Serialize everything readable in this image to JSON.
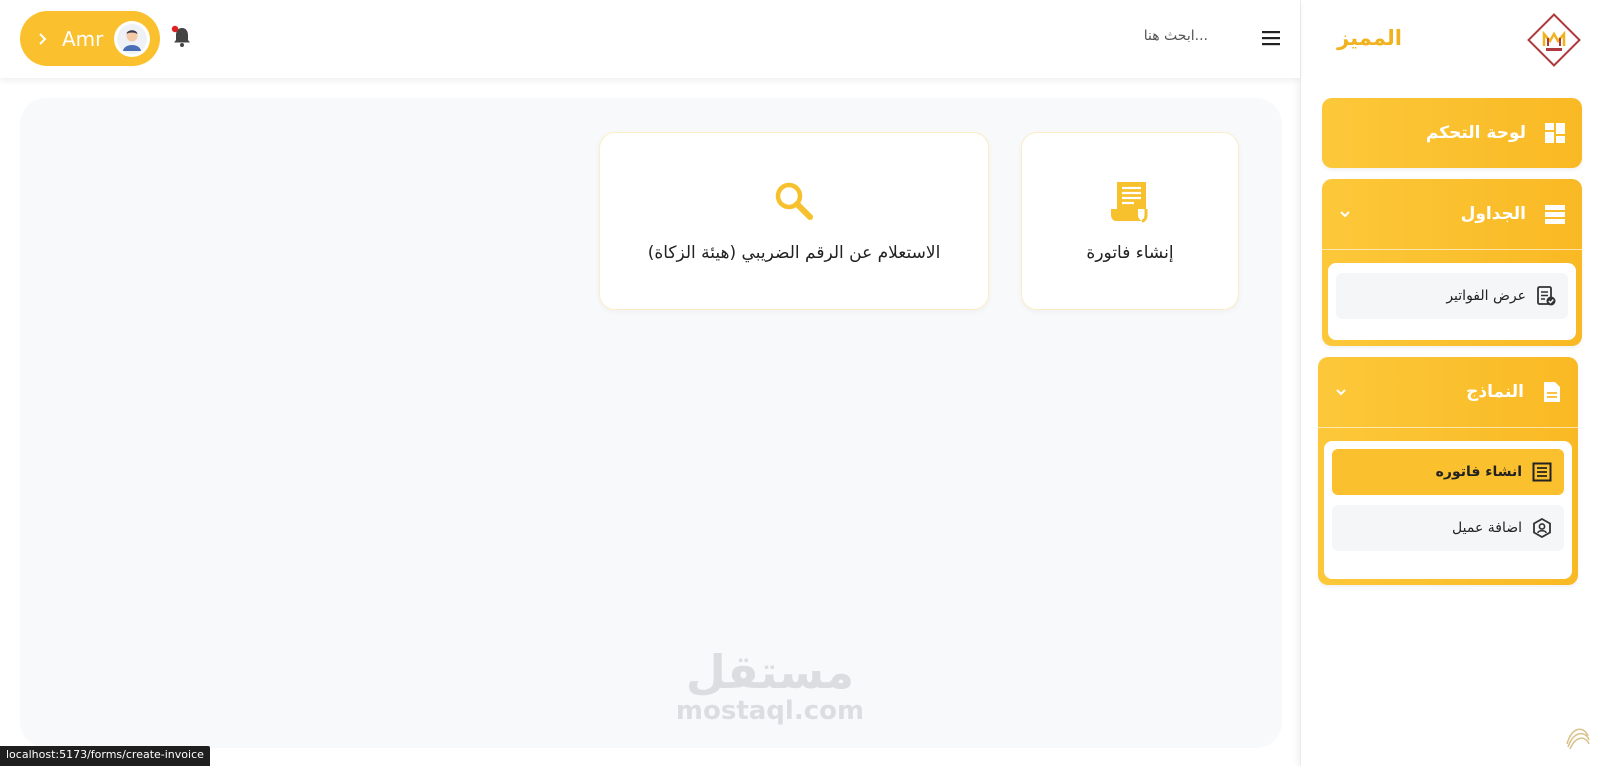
{
  "brand": {
    "name": "المميز"
  },
  "sidebar": {
    "dashboard_label": "لوحة التحكم",
    "tables": {
      "label": "الجداول",
      "items": [
        {
          "label": "عرض الفواتير"
        }
      ]
    },
    "forms": {
      "label": "النماذج",
      "items": [
        {
          "label": "انشاء فاتوره",
          "active": true
        },
        {
          "label": "اضافة عميل",
          "active": false
        }
      ]
    }
  },
  "header": {
    "user_name": "Amr",
    "search_placeholder": "ابحث هنا..."
  },
  "cards": [
    {
      "title": "إنشاء فاتورة",
      "icon": "receipt-icon"
    },
    {
      "title": "الاستعلام عن الرقم الضريبي (هيئة الزكاة)",
      "icon": "search-icon"
    }
  ],
  "watermark": {
    "arabic": "مستقل",
    "latin": "mostaql.com"
  },
  "status_bar": {
    "url": "localhost:5173/forms/create-invoice"
  },
  "colors": {
    "accent": "#fbc02d",
    "accent_light": "#fcc83a",
    "content_bg": "#f8f9fb"
  }
}
